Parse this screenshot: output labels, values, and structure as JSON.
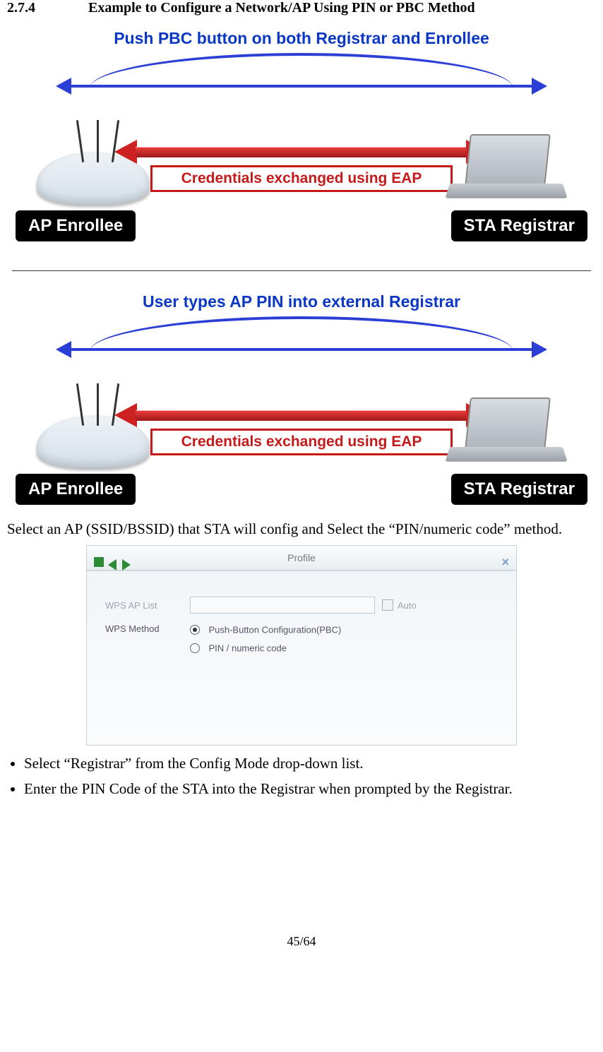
{
  "section": {
    "number": "2.7.4",
    "title": "Example to Configure a Network/AP Using PIN or PBC Method"
  },
  "diagram1": {
    "title": "Push PBC button on both Registrar and Enrollee",
    "credentials": "Credentials exchanged using EAP",
    "left_label": "AP Enrollee",
    "right_label": "STA Registrar"
  },
  "diagram2": {
    "title": "User types AP PIN into external Registrar",
    "credentials": "Credentials exchanged using EAP",
    "left_label": "AP Enrollee",
    "right_label": "STA Registrar"
  },
  "intro_text": "Select an AP (SSID/BSSID) that STA will config and Select the “PIN/numeric code” method.",
  "dialog": {
    "title": "Profile",
    "wps_list_label": "WPS AP List",
    "auto_label": "Auto",
    "wps_method_label": "WPS Method",
    "radio_pbc": "Push-Button Configuration(PBC)",
    "radio_pin": "PIN / numeric code"
  },
  "bullets": [
    "Select “Registrar” from the Config Mode drop-down list.",
    "Enter the PIN Code of the STA into the Registrar when prompted by the Registrar."
  ],
  "footer": "45/64"
}
